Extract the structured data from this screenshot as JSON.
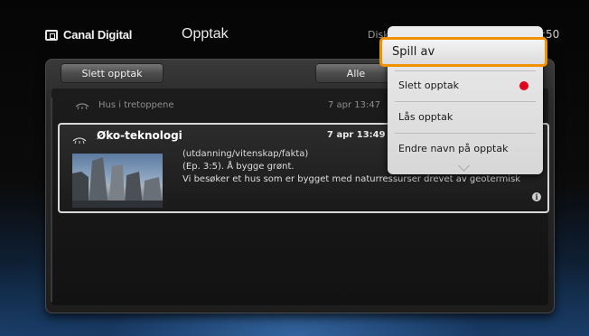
{
  "header": {
    "brand": "Canal Digital",
    "title": "Opptak",
    "disk_label": "Disk",
    "clock": ":50"
  },
  "toolbar": {
    "delete_label": "Slett opptak",
    "filter_label": "Alle"
  },
  "recordings": [
    {
      "title": "Hus i tretoppene",
      "date": "7 apr 13:47",
      "expanded": false
    },
    {
      "title": "Øko-teknologi",
      "date": "7 apr 13:49",
      "expanded": true,
      "genre": "(utdanning/vitenskap/fakta)",
      "episode": "(Ep. 3:5).  Å bygge grønt.",
      "description": "Vi besøker et hus som er bygget med naturressurser drevet av geotermisk"
    }
  ],
  "context_menu": {
    "items": [
      {
        "label": "Spill av",
        "selected": true
      },
      {
        "label": "Slett opptak",
        "badge_color": "#e3001b"
      },
      {
        "label": "Lås opptak"
      },
      {
        "label": "Endre navn på opptak"
      }
    ]
  },
  "colors": {
    "highlight": "#f29100",
    "delete_dot": "#e3001b"
  },
  "icons": {
    "brand": "tv-logo-icon",
    "recording": "recording-icon",
    "info": "info-icon",
    "more": "chevron-down-icon"
  }
}
